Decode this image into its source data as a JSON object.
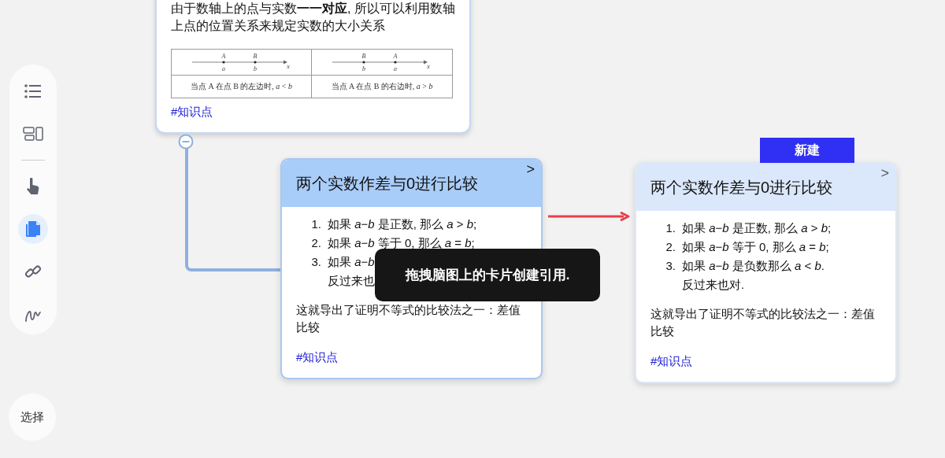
{
  "sidebar": {
    "tools": [
      {
        "selected": false
      },
      {
        "selected": false
      },
      {
        "selected": false
      },
      {
        "selected": true
      },
      {
        "selected": false
      },
      {
        "selected": false
      }
    ],
    "select_button": {
      "label": "选择"
    }
  },
  "top_card": {
    "text": "由于数轴上的点与实数**一一对应**, 所以可以利用数轴上点的位置关系来规定实数的大小关系",
    "figures": [
      {
        "points": [
          {
            "label": "A",
            "value": "a"
          },
          {
            "label": "B",
            "value": "b"
          }
        ],
        "axis": "x",
        "caption": "当点 A 在点 B 的左边时, *a* < *b*"
      },
      {
        "points": [
          {
            "label": "B",
            "value": "b"
          },
          {
            "label": "A",
            "value": "a"
          }
        ],
        "axis": "x",
        "caption": "当点 A 在点 B 的右边时, *a* > *b*"
      }
    ],
    "tag": "#知识点",
    "expanded": true
  },
  "cards": [
    {
      "selected": true,
      "chevron": ">",
      "title": "两个实数作差与0进行比较",
      "items": [
        {
          "number": "1.",
          "text": "如果 *a*−*b* 是正数, 那么 *a* > *b*;"
        },
        {
          "number": "2.",
          "text": "如果 *a*−*b* 等于 0, 那么 *a* = *b*;"
        },
        {
          "number": "3.",
          "text": "如果 *a*−*b*",
          "continuation": "反过来也"
        }
      ],
      "note": "这就导出了证明不等式的比较法之一：差值比较",
      "tag": "#知识点"
    },
    {
      "selected": false,
      "chevron": ">",
      "title": "两个实数作差与0进行比较",
      "items": [
        {
          "number": "1.",
          "text": "如果 *a*−*b* 是正数, 那么 *a* > *b*;"
        },
        {
          "number": "2.",
          "text": "如果 *a*−*b* 等于 0, 那么 *a* = *b*;"
        },
        {
          "number": "3.",
          "text": "如果 *a*−*b* 是负数那么 *a* < *b*.",
          "continuation": "反过来也对."
        }
      ],
      "note": "这就导出了证明不等式的比较法之一：差值比较",
      "tag": "#知识点"
    }
  ],
  "new_button": {
    "label": "新建"
  },
  "tooltip": {
    "text": "拖拽脑图上的卡片创建引用."
  }
}
